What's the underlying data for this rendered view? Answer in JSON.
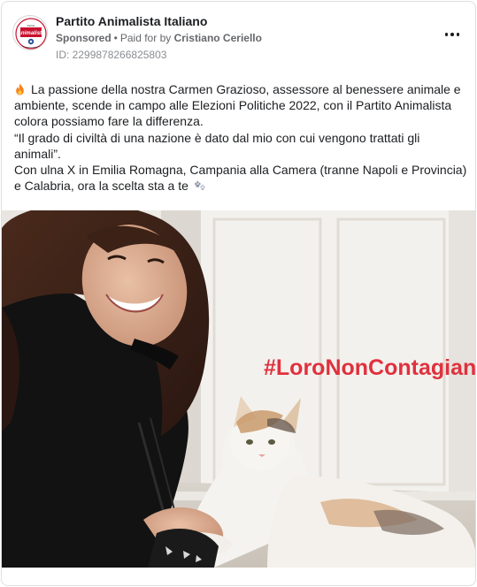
{
  "post": {
    "page_name": "Partito Animalista Italiano",
    "sponsored": "Sponsored",
    "separator": "•",
    "paid_for_prefix": "Paid for by",
    "payer": "Cristiano Ceriello",
    "ad_id": "ID: 2299878266825803",
    "more_icon": "more-options-icon",
    "avatar_logo_text": "Animalista"
  },
  "text": {
    "line1": "La passione della nostra Carmen Grazioso, assessore al benessere animale e ambiente, scende in campo alle Elezioni Politiche 2022, con il Partito Animalista colora possiamo fare la differenza.",
    "line2": "“Il grado di civiltà di una nazione è dato dal mio con cui vengono trattati gli animali”.",
    "line3": "Con ulna X in Emilia Romagna, Campania alla Camera (tranne Napoli e Provincia) e Calabria, ora la scelta sta a te",
    "lead_emoji": "fire-icon",
    "trail_emoji": "paw-prints-icon"
  },
  "image": {
    "hashtag": "#LoroNonContagiano",
    "hashtag_color": "#e0313e"
  },
  "colors": {
    "brand_red": "#e0313e",
    "text": "#1c1e21",
    "muted": "#65676b"
  }
}
